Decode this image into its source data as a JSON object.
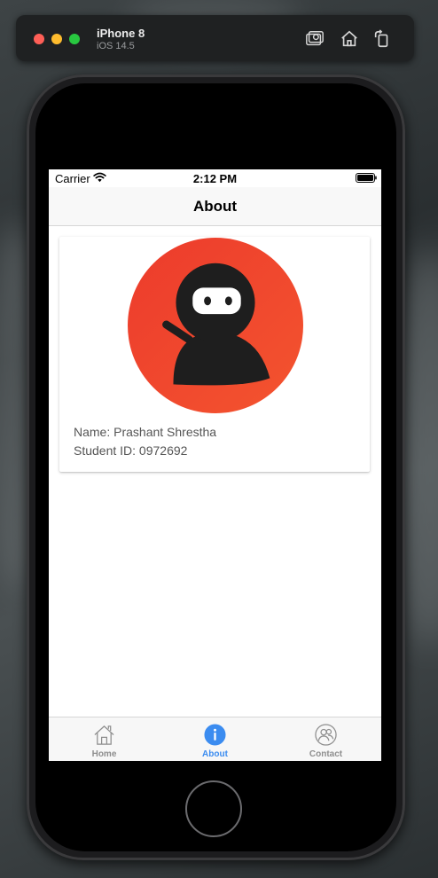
{
  "simulator": {
    "device_name": "iPhone 8",
    "os_version": "iOS 14.5",
    "buttons": [
      "screenshot-icon",
      "home-icon",
      "rotate-icon"
    ]
  },
  "status_bar": {
    "carrier": "Carrier",
    "time": "2:12 PM"
  },
  "nav": {
    "title": "About"
  },
  "profile": {
    "name_line": "Name: Prashant Shrestha",
    "id_line": "Student ID: 0972692",
    "avatar_icon": "ninja-avatar-icon"
  },
  "tabs": [
    {
      "label": "Home",
      "icon": "home-icon",
      "active": false
    },
    {
      "label": "About",
      "icon": "info-icon",
      "active": true
    },
    {
      "label": "Contact",
      "icon": "contact-icon",
      "active": false
    }
  ],
  "colors": {
    "accent": "#3b8cf0",
    "inactive": "#8e8e8e",
    "avatar_bg": "#f04a2f",
    "ninja": "#1e1e1e"
  }
}
